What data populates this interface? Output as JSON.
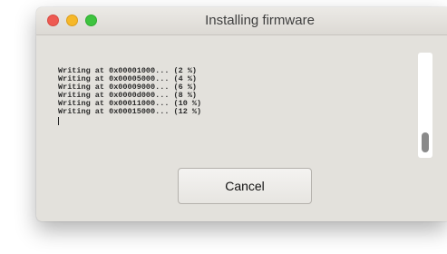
{
  "window": {
    "title": "Installing firmware",
    "controls": [
      "close",
      "minimize",
      "zoom"
    ]
  },
  "log": {
    "lines": [
      "Writing at 0x00001000... (2 %)",
      "Writing at 0x00005000... (4 %)",
      "Writing at 0x00009000... (6 %)",
      "Writing at 0x0000d000... (8 %)",
      "Writing at 0x00011000... (10 %)",
      "Writing at 0x00015000... (12 %)"
    ]
  },
  "actions": {
    "cancel_label": "Cancel"
  },
  "colors": {
    "window_background": "#e3e1dc",
    "close": "#ee5a52",
    "minimize": "#f6b829",
    "zoom": "#3ec33f"
  }
}
